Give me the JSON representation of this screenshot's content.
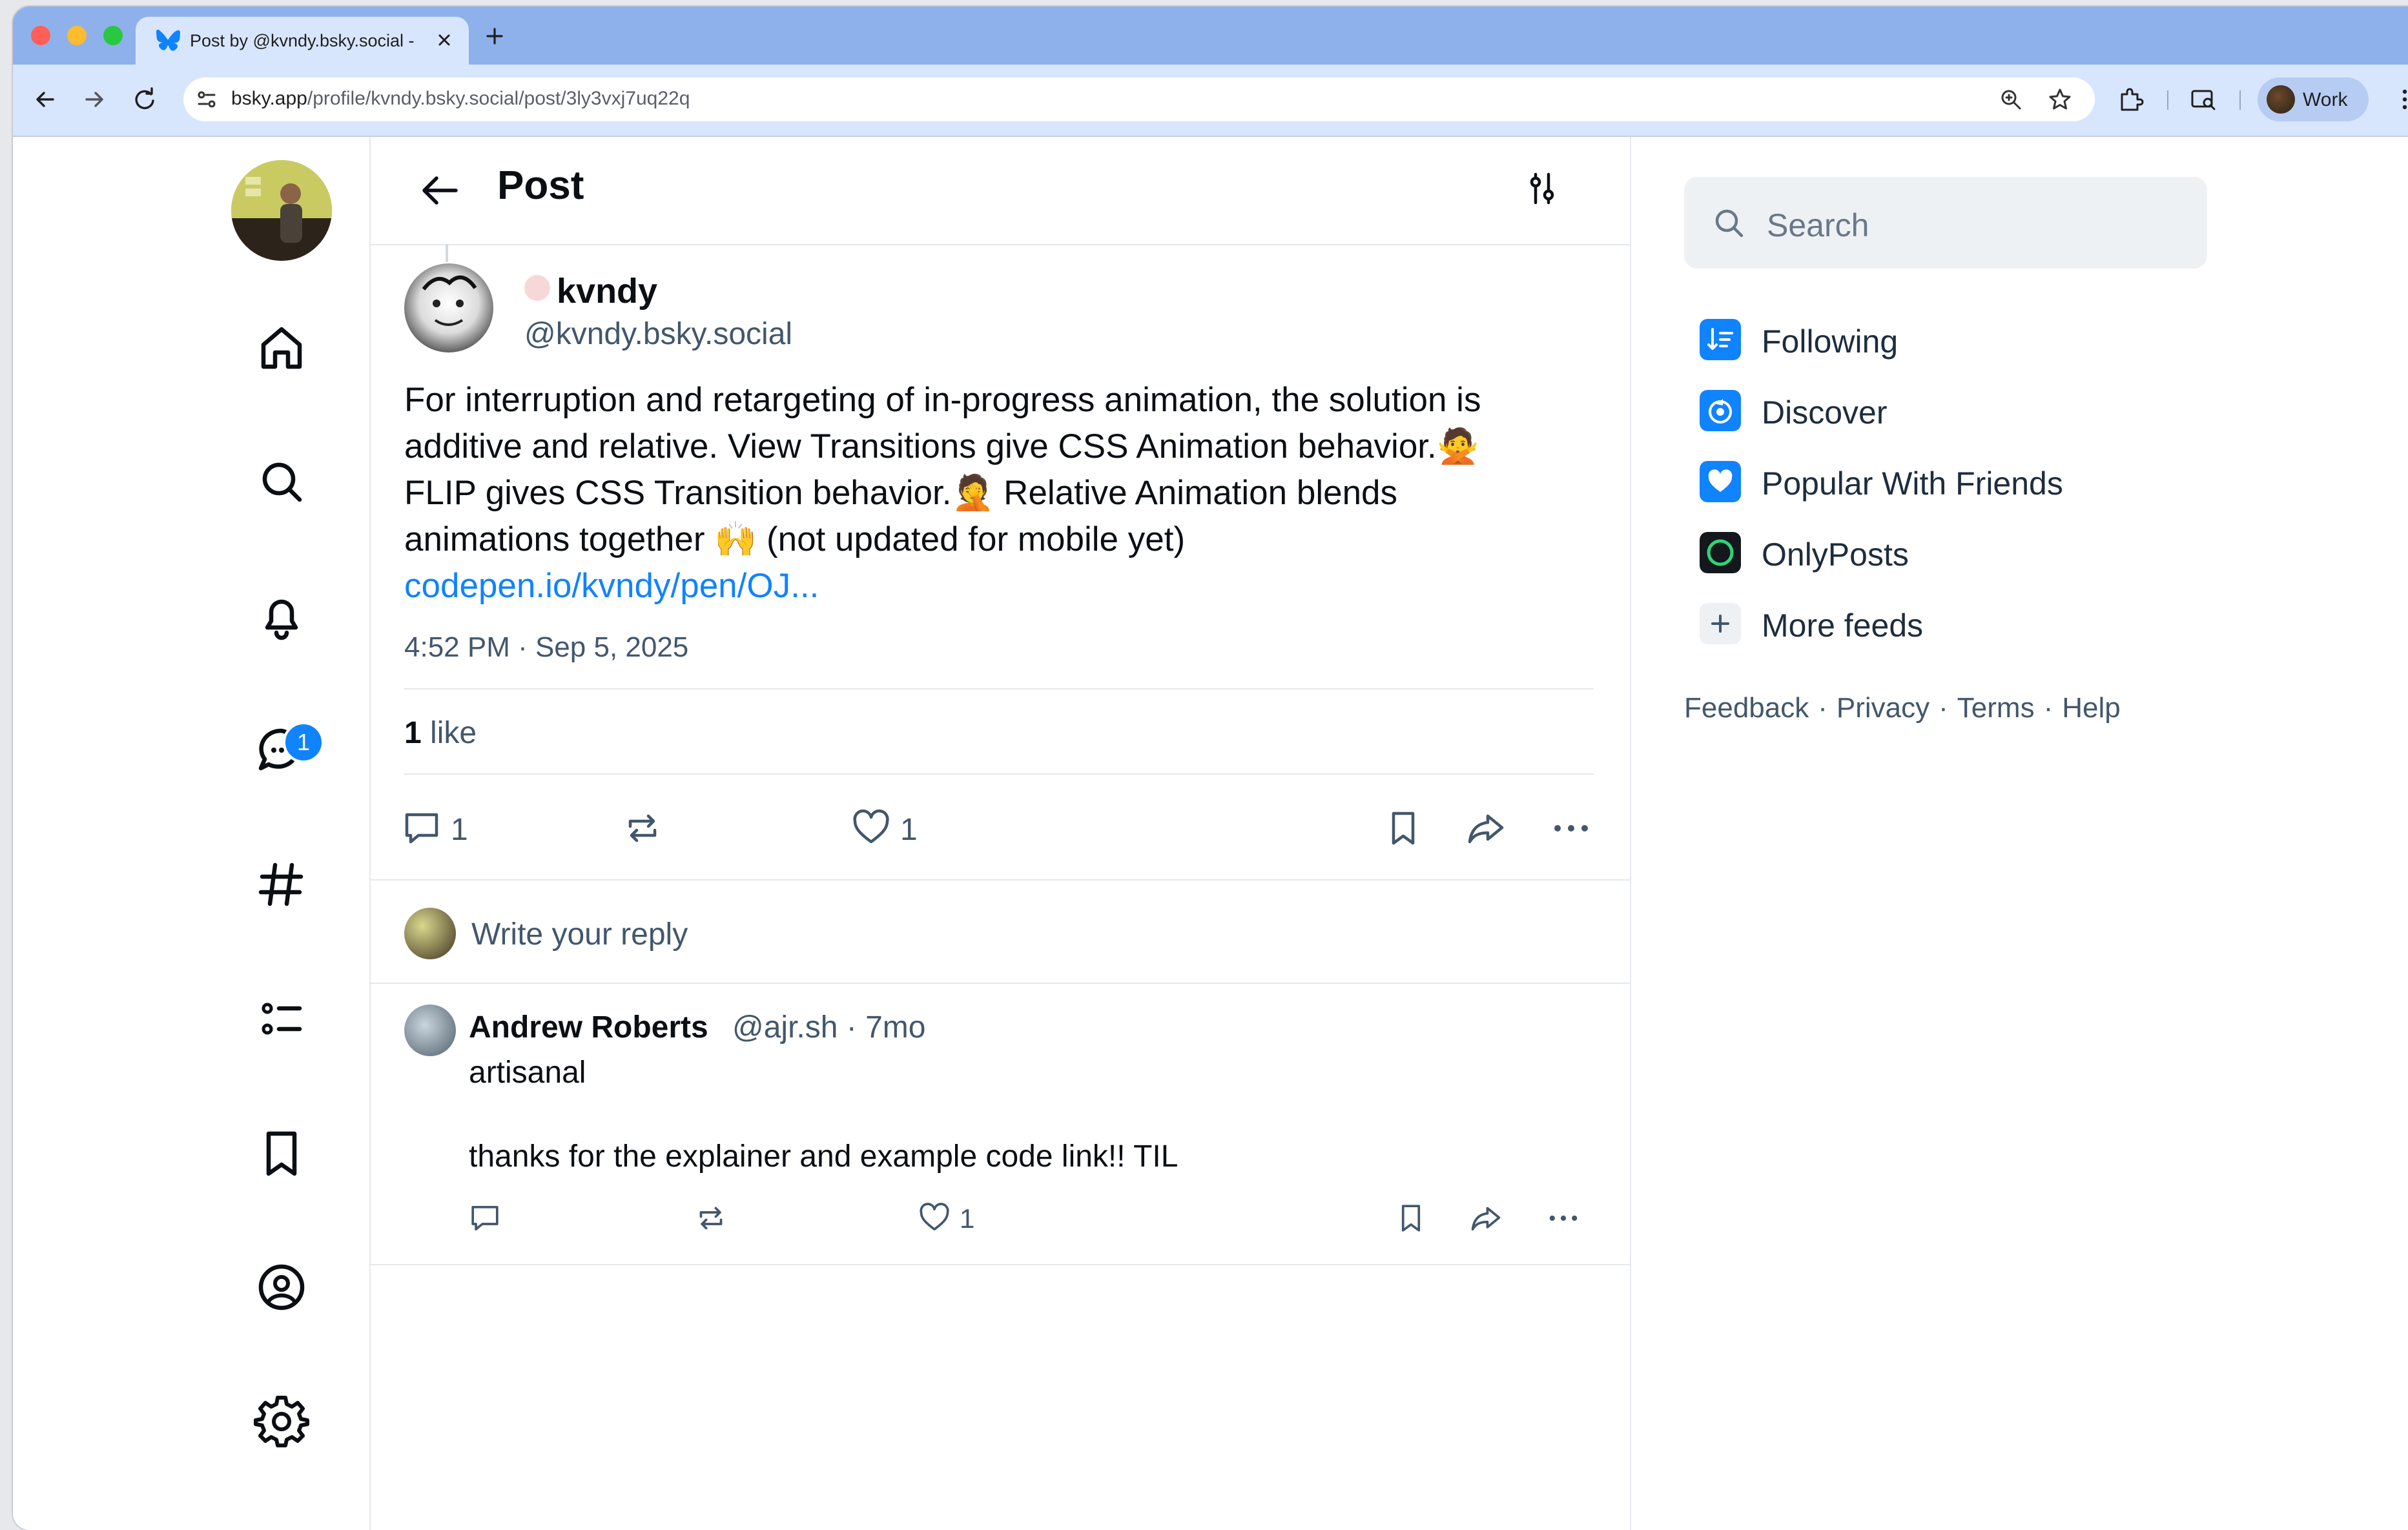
{
  "browser": {
    "tab_title": "Post by @kvndy.bsky.social -",
    "url_host": "bsky.app",
    "url_path": "/profile/kvndy.bsky.social/post/3ly3vxj7uq22q",
    "profile_label": "Work"
  },
  "header": {
    "title": "Post"
  },
  "nav": {
    "chat_badge": "1"
  },
  "post": {
    "author_name": "kvndy",
    "author_handle": "@kvndy.bsky.social",
    "text_line1": "For interruption and retargeting of in-progress animation, the solution is",
    "text_line2": "additive and relative. View Transitions give CSS Animation behavior.🙅",
    "text_line3": "FLIP gives CSS Transition behavior.🤦 Relative Animation blends",
    "text_line4": "animations together 🙌 (not updated for mobile yet)",
    "link": "codepen.io/kvndy/pen/OJ...",
    "meta": "4:52 PM · Sep 5, 2025",
    "likes_count": "1",
    "likes_word": "like",
    "reply_count": "1",
    "like_count": "1"
  },
  "reply_box": {
    "placeholder": "Write your reply"
  },
  "comment": {
    "name": "Andrew Roberts",
    "handle_time": "@ajr.sh · 7mo",
    "line1": "artisanal",
    "line2": "thanks for the explainer and example code link!! TIL",
    "like_count": "1"
  },
  "search": {
    "placeholder": "Search"
  },
  "feeds": [
    {
      "label": "Following",
      "icon": "following-feed-icon",
      "color": "#1083fe"
    },
    {
      "label": "Discover",
      "icon": "discover-feed-icon",
      "color": "#1083fe"
    },
    {
      "label": "Popular With Friends",
      "icon": "heart-feed-icon",
      "color": "#1083fe"
    },
    {
      "label": "OnlyPosts",
      "icon": "onlyposts-feed-icon",
      "color": "#14171b"
    },
    {
      "label": "More feeds",
      "icon": "plus-icon",
      "color": "#eef1f4"
    }
  ],
  "footer": {
    "feedback": "Feedback",
    "privacy": "Privacy",
    "terms": "Terms",
    "help": "Help",
    "dot": "·"
  },
  "colors": {
    "accent": "#1083fe",
    "muted_text": "#42576c",
    "tab_strip": "#8fb1eb"
  }
}
